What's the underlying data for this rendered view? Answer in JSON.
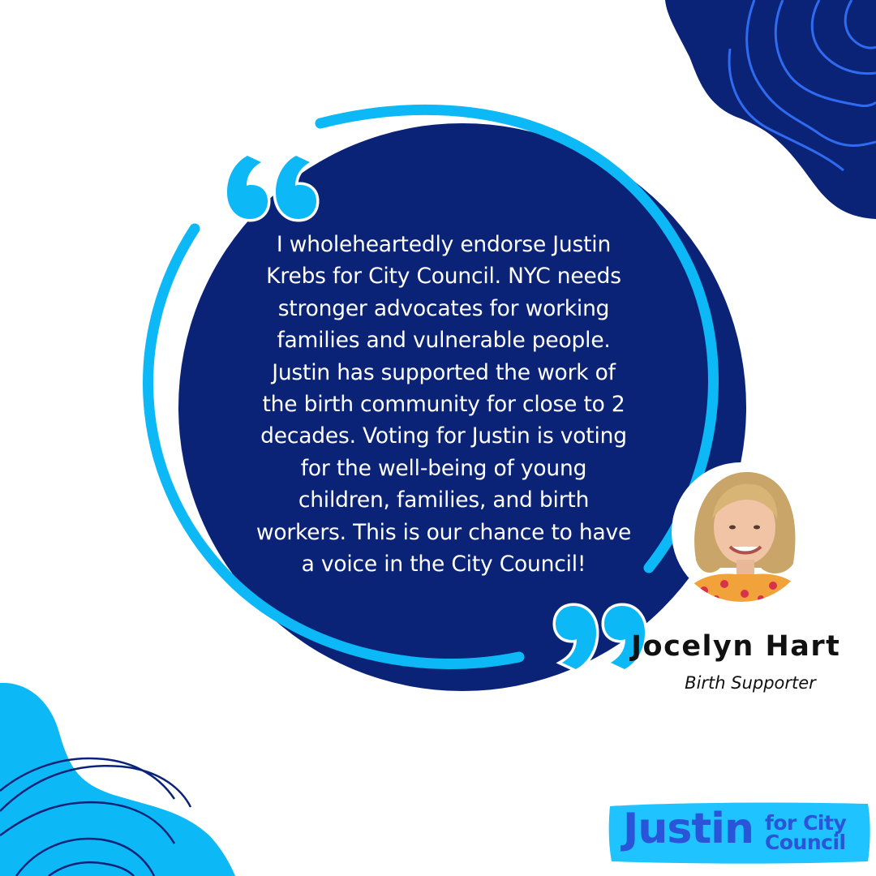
{
  "quote": {
    "text": "I wholeheartedly endorse Justin Krebs for City Council. NYC needs stronger advocates for working families and vulnerable people. Justin has supported the work of the birth community for close to 2 decades. Voting for Justin is voting for the well-being of young children, families, and birth workers. This is our chance to have a voice in the City Council!"
  },
  "endorser": {
    "name": "Jocelyn Hart",
    "role": "Birth Supporter"
  },
  "logo": {
    "main": "Justin",
    "sub_line1": "for City",
    "sub_line2": "Council"
  },
  "colors": {
    "navy": "#0a2377",
    "light_blue": "#0cb8f5",
    "logo_blue": "#2a55d8",
    "white": "#ffffff"
  },
  "icons": [
    "open-quote-icon",
    "close-quote-icon",
    "decorative-blob-top-right",
    "decorative-blob-bottom-left"
  ]
}
